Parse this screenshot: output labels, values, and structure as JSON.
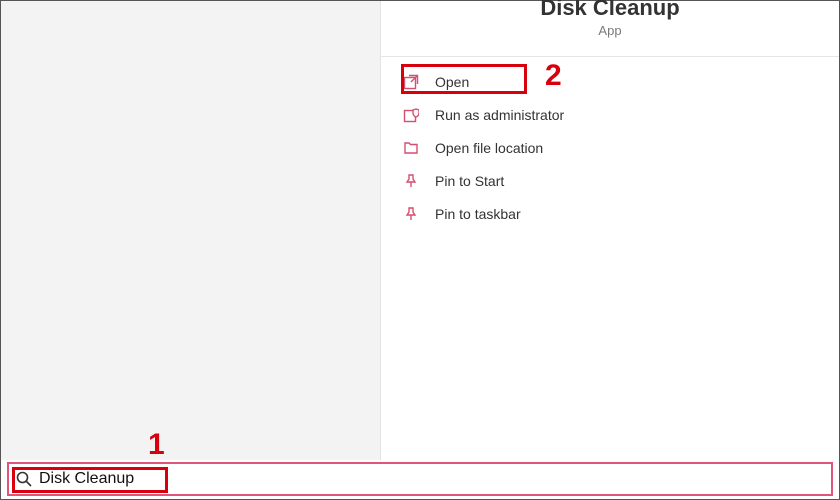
{
  "header": {
    "title": "Disk Cleanup",
    "subtitle": "App"
  },
  "menu": {
    "open": "Open",
    "run_admin": "Run as administrator",
    "open_loc": "Open file location",
    "pin_start": "Pin to Start",
    "pin_taskbar": "Pin to taskbar"
  },
  "search": {
    "value": "Disk Cleanup",
    "placeholder": ""
  },
  "annotations": {
    "num1": "1",
    "num2": "2"
  }
}
